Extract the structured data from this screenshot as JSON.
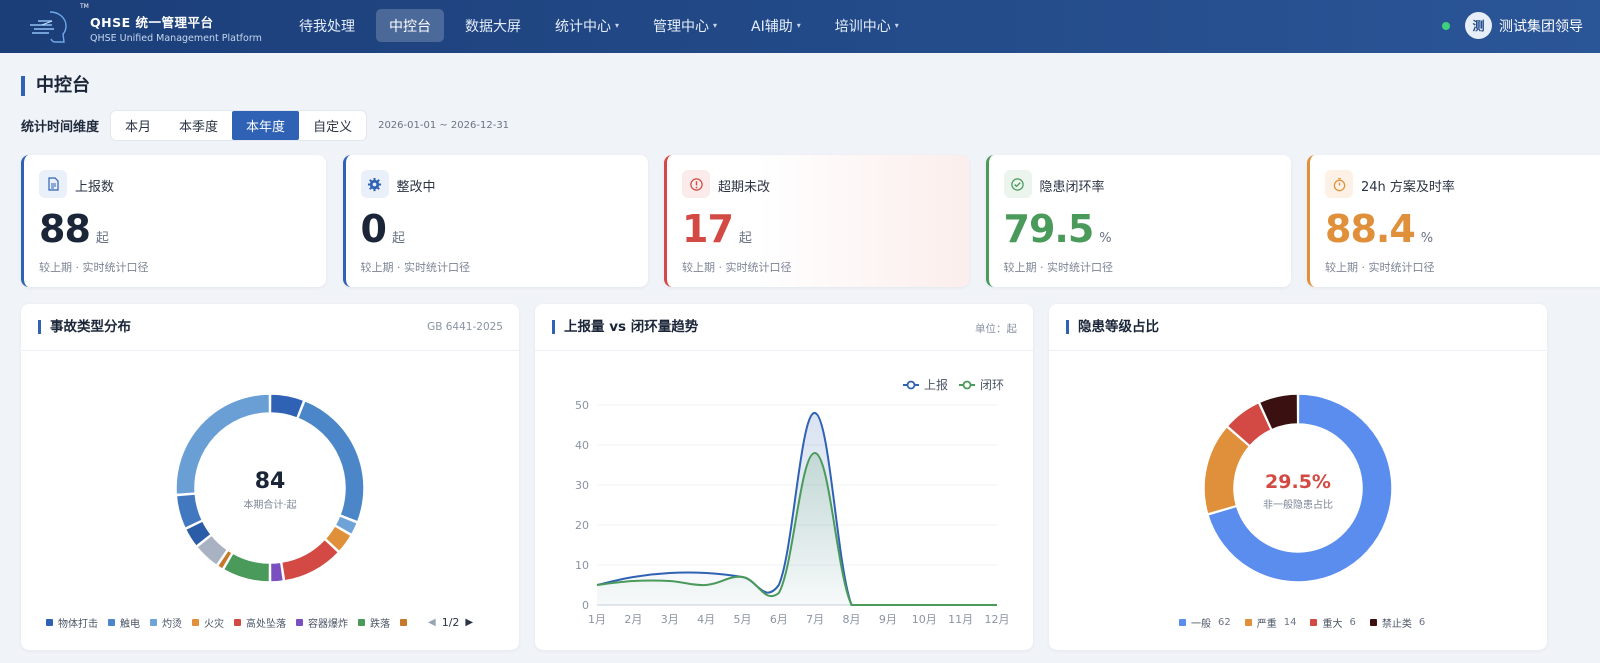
{
  "header": {
    "brand_title": "QHSE 统一管理平台",
    "brand_sub": "QHSE Unified Management Platform",
    "tm": "TM",
    "nav": [
      {
        "label": "待我处理",
        "caret": false
      },
      {
        "label": "中控台",
        "caret": false,
        "active": true
      },
      {
        "label": "数据大屏",
        "caret": false
      },
      {
        "label": "统计中心",
        "caret": true
      },
      {
        "label": "管理中心",
        "caret": true
      },
      {
        "label": "AI辅助",
        "caret": true
      },
      {
        "label": "培训中心",
        "caret": true
      }
    ],
    "avatar_char": "测",
    "user_name": "测试集团领导"
  },
  "page": {
    "title": "中控台",
    "range_label": "统计时间维度",
    "range_options": [
      "本月",
      "本季度",
      "本年度",
      "自定义"
    ],
    "range_selected": "本年度",
    "range_dates": "2026-01-01 ~ 2026-12-31"
  },
  "kpis": [
    {
      "name": "上报数",
      "value": "88",
      "unit": "起",
      "compare": "较上期 · 实时统计口径",
      "color": "#2f62b4",
      "value_color": "#1a2538",
      "icon": "document-icon"
    },
    {
      "name": "整改中",
      "value": "0",
      "unit": "起",
      "compare": "较上期 · 实时统计口径",
      "color": "#2f62b4",
      "value_color": "#1a2538",
      "icon": "gear-icon"
    },
    {
      "name": "超期未改",
      "value": "17",
      "unit": "起",
      "compare": "较上期 · 实时统计口径",
      "color": "#d24a43",
      "value_color": "#d24a43",
      "icon": "alert-icon"
    },
    {
      "name": "隐患闭环率",
      "value": "79.5",
      "unit": "%",
      "compare": "较上期 · 实时统计口径",
      "color": "#4a9a5b",
      "value_color": "#4a9a5b",
      "icon": "check-circle-icon"
    },
    {
      "name": "24h 方案及时率",
      "value": "88.4",
      "unit": "%",
      "compare": "较上期 · 实时统计口径",
      "color": "#e0903a",
      "value_color": "#e0903a",
      "icon": "timer-icon"
    }
  ],
  "panels": {
    "accident": {
      "title": "事故类型分布",
      "note": "GB 6441-2025",
      "center_value": "84",
      "center_label": "本期合计·起",
      "pager": "1/2"
    },
    "trend": {
      "title": "上报量 vs 闭环量趋势",
      "note": "单位：起"
    },
    "level": {
      "title": "隐患等级占比",
      "center_value": "29.5%",
      "center_label": "非一般隐患占比"
    }
  },
  "chart_data": [
    {
      "type": "pie",
      "title": "事故类型分布",
      "slices": [
        {
          "label": "物体打击",
          "value": 5,
          "color": "#2f62b4"
        },
        {
          "label": "触电",
          "value": 21,
          "color": "#4a86c8"
        },
        {
          "label": "灼烫",
          "value": 2,
          "color": "#6fa3d8"
        },
        {
          "label": "火灾",
          "value": 3,
          "color": "#e0903a"
        },
        {
          "label": "高处坠落",
          "value": 9,
          "color": "#d24a43"
        },
        {
          "label": "容器爆炸",
          "value": 2,
          "color": "#7a4fc0"
        },
        {
          "label": "跌落",
          "value": 7,
          "color": "#4a9a5b"
        },
        {
          "label": "",
          "value": 1,
          "color": "#c47a2a"
        },
        {
          "label": "",
          "value": 4,
          "color": "#a8b2c2"
        },
        {
          "label": "",
          "value": 3,
          "color": "#2b5ca8"
        },
        {
          "label": "",
          "value": 5,
          "color": "#4178c0"
        },
        {
          "label": "",
          "value": 22,
          "color": "#6a9fd6"
        }
      ],
      "visible_legend": [
        "物体打击",
        "触电",
        "灼烫",
        "火灾",
        "高处坠落",
        "容器爆炸",
        "跌落",
        ""
      ]
    },
    {
      "type": "line",
      "title": "上报量 vs 闭环量趋势",
      "categories": [
        "1月",
        "2月",
        "3月",
        "4月",
        "5月",
        "6月",
        "7月",
        "8月",
        "9月",
        "10月",
        "11月",
        "12月"
      ],
      "ylim": [
        0,
        50
      ],
      "yticks": [
        0,
        10,
        20,
        30,
        40,
        50
      ],
      "series": [
        {
          "name": "上报",
          "values": [
            5,
            7,
            8,
            8,
            7,
            5,
            48,
            0,
            0,
            0,
            0,
            0
          ],
          "color": "#2f62b4"
        },
        {
          "name": "闭环",
          "values": [
            5,
            6,
            6,
            5,
            7,
            3,
            38,
            0,
            0,
            0,
            0,
            0
          ],
          "color": "#4a9a5b"
        }
      ],
      "legend": "top-right",
      "grid": true
    },
    {
      "type": "pie",
      "title": "隐患等级占比",
      "slices": [
        {
          "label": "一般",
          "value": 62,
          "color": "#5b8def"
        },
        {
          "label": "严重",
          "value": 14,
          "color": "#e0903a"
        },
        {
          "label": "重大",
          "value": 6,
          "color": "#d24a43"
        },
        {
          "label": "禁止类",
          "value": 6,
          "color": "#3a1010"
        }
      ]
    }
  ]
}
